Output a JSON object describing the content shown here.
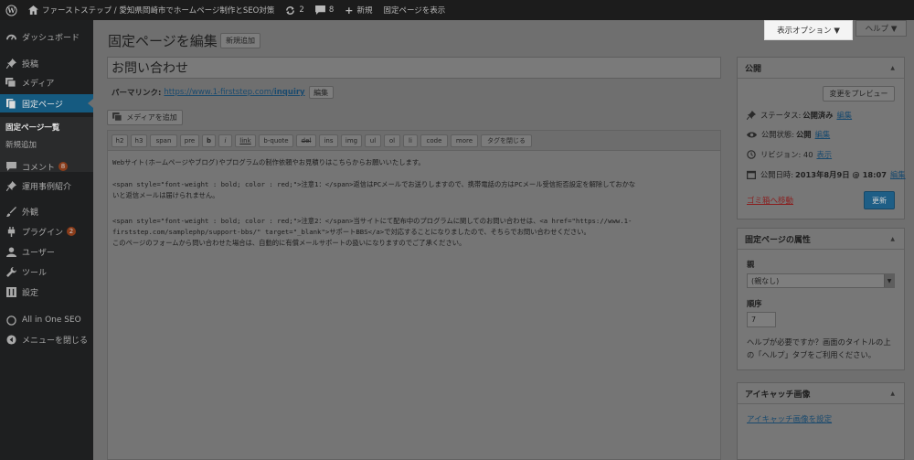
{
  "admin_bar": {
    "site_name": "ファーストステップ / 愛知県岡崎市でホームページ制作とSEO対策",
    "updates_count": "2",
    "comments_count": "8",
    "new_label": "新規",
    "view_page_label": "固定ページを表示"
  },
  "sidebar": {
    "dashboard": "ダッシュボード",
    "posts": "投稿",
    "media": "メディア",
    "pages": "固定ページ",
    "pages_all": "固定ページ一覧",
    "pages_new": "新規追加",
    "comments": "コメント",
    "comments_badge": "8",
    "works": "運用事例紹介",
    "appearance": "外観",
    "plugins": "プラグイン",
    "plugins_badge": "2",
    "users": "ユーザー",
    "tools": "ツール",
    "settings": "設定",
    "seo": "All in One SEO",
    "collapse": "メニューを閉じる"
  },
  "header": {
    "title": "固定ページを編集",
    "add_new": "新規追加",
    "screen_options": "表示オプション ▼",
    "help": "ヘルプ ▼"
  },
  "editor": {
    "post_title": "お問い合わせ",
    "permalink_label": "パーマリンク:",
    "permalink_base": "https://www.1-firststep.com/",
    "permalink_slug": "inquiry",
    "edit_label": "編集",
    "add_media": "メディアを追加",
    "quicktags": [
      "h2",
      "h3",
      "span",
      "pre",
      "b",
      "i",
      "link",
      "b-quote",
      "del",
      "ins",
      "img",
      "ul",
      "ol",
      "li",
      "code",
      "more",
      "タグを閉じる"
    ],
    "content_lines": [
      "Webサイト(ホームページやブログ)やプログラムの制作依頼やお見積りはこちらからお願いいたします。",
      "",
      "<span style=\"font-weight : bold; color : red;\">注意1：</span>返信はPCメールでお送りしますので、携帯電話の方はPCメール受信拒否設定を解除しておかな",
      "いと返信メールは届けられません。",
      "",
      "<span style=\"font-weight : bold; color : red;\">注意2：</span>当サイトにて配布中のプログラムに関してのお問い合わせは、<a href=\"https://www.1-",
      "firststep.com/samplephp/support-bbs/\" target=\"_blank\">サポートBBS</a>で対応することになりましたので、そちらでお問い合わせください。",
      "このページのフォームから問い合わせた場合は、自動的に有償メールサポートの扱いになりますのでご了承ください。"
    ]
  },
  "publish": {
    "title": "公開",
    "preview": "変更をプレビュー",
    "status_label": "ステータス:",
    "status_value": "公開済み",
    "visibility_label": "公開状態:",
    "visibility_value": "公開",
    "revisions_label": "リビジョン: 40",
    "revisions_link": "表示",
    "date_label": "公開日時:",
    "date_value": "2013年8月9日 @ 18:07",
    "edit": "編集",
    "trash": "ゴミ箱へ移動",
    "update": "更新"
  },
  "attributes": {
    "title": "固定ページの属性",
    "parent_label": "親",
    "parent_value": "(親なし)",
    "order_label": "順序",
    "order_value": "7",
    "help_text_1": "ヘルプが必要ですか？画面のタイトルの上",
    "help_text_2": "の「ヘルプ」タブをご利用ください。"
  },
  "thumbnail": {
    "title": "アイキャッチ画像",
    "set_link": "アイキャッチ画像を設定"
  }
}
